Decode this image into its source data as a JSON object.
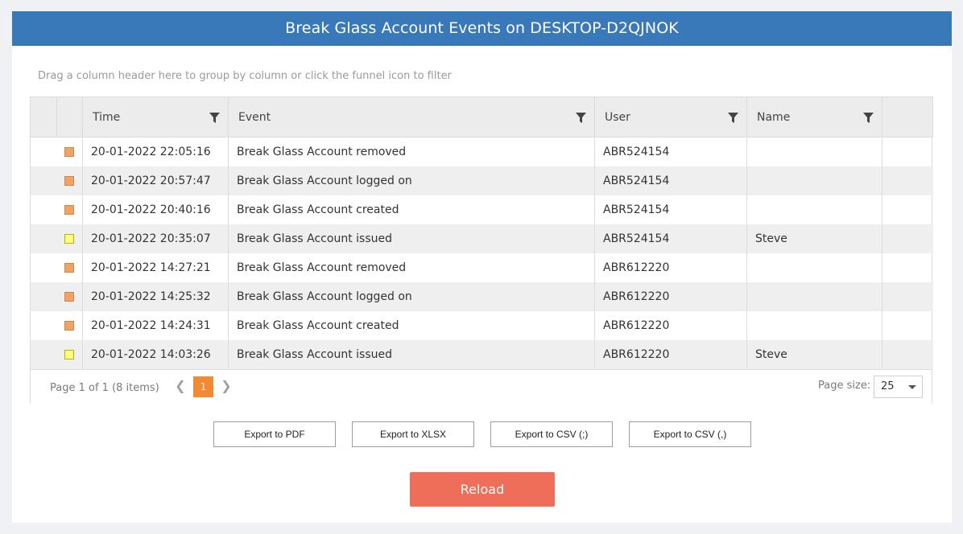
{
  "title": "Break Glass Account Events on DESKTOP-D2QJNOK",
  "group_hint": "Drag a column header here to group by column or click the funnel icon to filter",
  "columns": [
    "Time",
    "Event",
    "User",
    "Name"
  ],
  "colors": {
    "header_bar": "#3a79b9",
    "marker_orange": "#f4a261",
    "marker_yellow": "#ffff80",
    "page_active": "#f28a33",
    "reload": "#ee6e5a"
  },
  "rows": [
    {
      "marker": "orange",
      "time": "20-01-2022 22:05:16",
      "event": "Break Glass Account removed",
      "user": "ABR524154",
      "name": ""
    },
    {
      "marker": "orange",
      "time": "20-01-2022 20:57:47",
      "event": "Break Glass Account logged on",
      "user": "ABR524154",
      "name": ""
    },
    {
      "marker": "orange",
      "time": "20-01-2022 20:40:16",
      "event": "Break Glass Account created",
      "user": "ABR524154",
      "name": ""
    },
    {
      "marker": "yellow",
      "time": "20-01-2022 20:35:07",
      "event": "Break Glass Account issued",
      "user": "ABR524154",
      "name": "Steve"
    },
    {
      "marker": "orange",
      "time": "20-01-2022 14:27:21",
      "event": "Break Glass Account removed",
      "user": "ABR612220",
      "name": ""
    },
    {
      "marker": "orange",
      "time": "20-01-2022 14:25:32",
      "event": "Break Glass Account logged on",
      "user": "ABR612220",
      "name": ""
    },
    {
      "marker": "orange",
      "time": "20-01-2022 14:24:31",
      "event": "Break Glass Account created",
      "user": "ABR612220",
      "name": ""
    },
    {
      "marker": "yellow",
      "time": "20-01-2022 14:03:26",
      "event": "Break Glass Account issued",
      "user": "ABR612220",
      "name": "Steve"
    }
  ],
  "pager": {
    "info": "Page 1 of 1 (8 items)",
    "current_page": "1",
    "prev_icon": "chevron-left-icon",
    "next_icon": "chevron-right-icon",
    "page_size_label": "Page size:",
    "page_size": "25"
  },
  "exports": [
    "Export to PDF",
    "Export to XLSX",
    "Export to CSV (;)",
    "Export to CSV (,)"
  ],
  "reload_label": "Reload"
}
